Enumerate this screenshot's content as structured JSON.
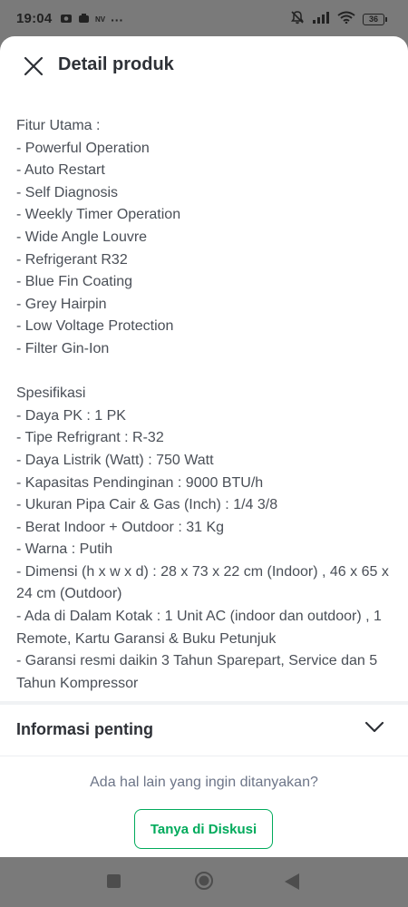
{
  "status_bar": {
    "time": "19:04",
    "notification_label": "NV",
    "more": "···",
    "battery": "36"
  },
  "header": {
    "title": "Detail produk"
  },
  "description": {
    "features_heading": "Fitur Utama :",
    "features": [
      "- Powerful Operation",
      "- Auto Restart",
      "- Self Diagnosis",
      "- Weekly Timer Operation",
      "- Wide Angle Louvre",
      "- Refrigerant R32",
      "- Blue Fin Coating",
      "- Grey Hairpin",
      "- Low Voltage Protection",
      "- Filter Gin-Ion"
    ],
    "specs_heading": "Spesifikasi",
    "specs": [
      "- Daya PK : 1 PK",
      "- Tipe Refrigrant : R-32",
      "- Daya Listrik (Watt) : 750 Watt",
      "- Kapasitas Pendinginan : 9000 BTU/h",
      "- Ukuran Pipa Cair & Gas (Inch) : 1/4 3/8",
      "- Berat Indoor + Outdoor : 31 Kg",
      "- Warna : Putih",
      "- Dimensi (h x w x d) : 28 x 73 x 22 cm (Indoor) , 46 x 65 x 24 cm (Outdoor)",
      "- Ada di Dalam Kotak : 1 Unit AC (indoor dan outdoor) , 1 Remote, Kartu Garansi & Buku Petunjuk",
      "- Garansi resmi daikin 3 Tahun Sparepart, Service dan 5 Tahun Kompressor"
    ]
  },
  "info_section": {
    "title": "Informasi penting"
  },
  "footer": {
    "question": "Ada hal lain yang ingin ditanyakan?",
    "discuss_button": "Tanya di Diskusi"
  },
  "colors": {
    "accent_green": "#00aa5b",
    "text_dark": "#2e3137",
    "text_body": "#4a4f57",
    "overlay": "#7a7a7a"
  },
  "icons": {
    "close": "close-icon",
    "chevron": "chevron-down-icon",
    "nav_square": "recent-apps-icon",
    "nav_circle": "home-icon",
    "nav_back": "back-icon"
  }
}
